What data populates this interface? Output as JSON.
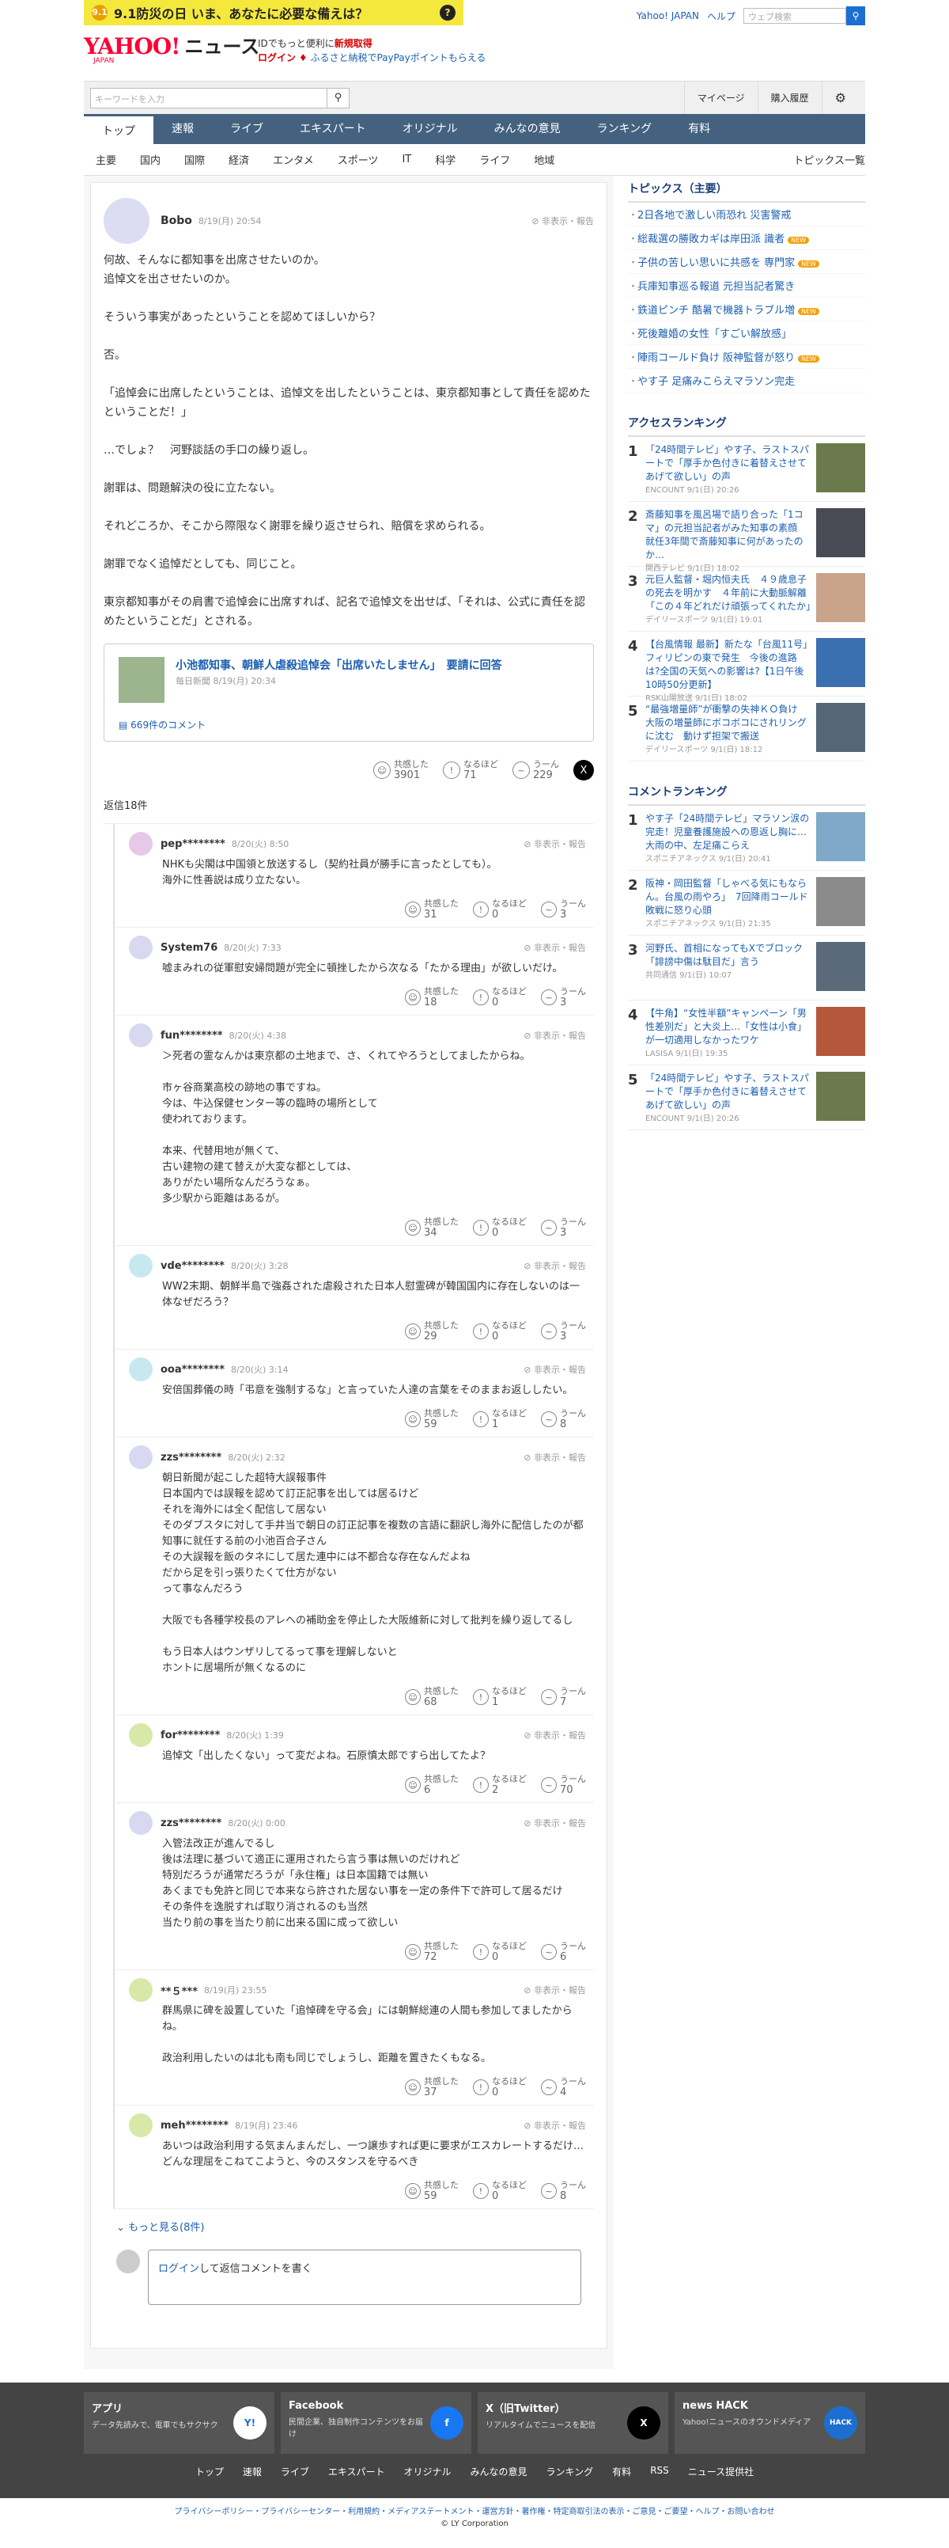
{
  "banner": {
    "icon": "9.1",
    "text": "9.1防災の日 いま、あなたに必要な備えは？"
  },
  "top_links": {
    "yahoo_japan": "Yahoo! JAPAN",
    "help": "ヘルプ",
    "search_placeholder": "ウェブ検索"
  },
  "logo": {
    "yahoo": "YAHOO!",
    "japan": "JAPAN",
    "news": "ニュース"
  },
  "promo": {
    "line1_prefix": "IDでもっと便利に",
    "line1_link": "新規取得",
    "login": "ログイン",
    "line2": "ふるさと納税でPayPayポイントもらえる"
  },
  "searchbar": {
    "placeholder": "キーワードを入力",
    "mypage": "マイページ",
    "history": "購入履歴"
  },
  "global_nav": [
    "トップ",
    "速報",
    "ライブ",
    "エキスパート",
    "オリジナル",
    "みんなの意見",
    "ランキング",
    "有料"
  ],
  "sub_nav": [
    "主要",
    "国内",
    "国際",
    "経済",
    "エンタメ",
    "スポーツ",
    "IT",
    "科学",
    "ライフ",
    "地域"
  ],
  "sub_nav_more": "トピックス一覧",
  "post": {
    "user": "Bobo",
    "time": "8/19(月) 20:54",
    "report": "非表示・報告",
    "paragraphs": [
      "何故、そんなに都知事を出席させたいのか。\n追悼文を出させたいのか。",
      "そういう事実があったということを認めてほしいから？",
      "否。",
      "「追悼会に出席したということは、追悼文を出したということは、東京都知事として責任を認めたということだ！」",
      "…でしょ？　河野談話の手口の繰り返し。",
      "謝罪は、問題解決の役に立たない。",
      "それどころか、そこから際限なく謝罪を繰り返させられ、賠償を求められる。",
      "謝罪でなく追悼だとしても、同じこと。",
      "東京都知事がその肩書で追悼会に出席すれば、記名で追悼文を出せば、「それは、公式に責任を認めたということだ」とされる。"
    ],
    "card": {
      "title": "小池都知事、朝鮮人虐殺追悼会「出席いたしません」　要請に回答",
      "source": "毎日新聞 8/19(月) 20:34",
      "comments": "669件のコメント"
    },
    "reactions": {
      "agree_label": "共感した",
      "agree": "3901",
      "naruhodo_label": "なるほど",
      "naruhodo": "71",
      "uun_label": "うーん",
      "uun": "229"
    }
  },
  "reply_count": "返信18件",
  "replies": [
    {
      "user": "pep********",
      "time": "8/20(火) 8:50",
      "text": "NHKも尖閣は中国領と放送するし（契約社員が勝手に言ったとしても）。\n海外に性善説は成り立たない。",
      "agree": "31",
      "naruhodo": "0",
      "uun": "3"
    },
    {
      "user": "System76",
      "time": "8/20(火) 7:33",
      "text": "嘘まみれの従軍慰安婦問題が完全に頓挫したから次なる「たかる理由」が欲しいだけ。",
      "agree": "18",
      "naruhodo": "0",
      "uun": "3"
    },
    {
      "user": "fun********",
      "time": "8/20(火) 4:38",
      "text": "＞死者の霊なんかは東京都の土地まで、さ、くれてやろうとしてましたからね。\n\n市ヶ谷商業高校の跡地の事ですね。\n今は、牛込保健センター等の臨時の場所として\n使われております。\n\n本来、代替用地が無くて、\n古い建物の建て替えが大変な都としては、\nありがたい場所なんだろうなぁ。\n多少駅から距離はあるが。",
      "agree": "34",
      "naruhodo": "0",
      "uun": "3"
    },
    {
      "user": "vde********",
      "time": "8/20(火) 3:28",
      "text": "WW2末期、朝鮮半島で強姦された虐殺された日本人慰霊碑が韓国国内に存在しないのは一体なぜだろう？",
      "agree": "29",
      "naruhodo": "0",
      "uun": "3"
    },
    {
      "user": "ooa********",
      "time": "8/20(火) 3:14",
      "text": "安倍国葬儀の時「弔意を強制するな」と言っていた人達の言葉をそのままお返ししたい。",
      "agree": "59",
      "naruhodo": "1",
      "uun": "8"
    },
    {
      "user": "zzs********",
      "time": "8/20(火) 2:32",
      "text": "朝日新聞が起こした超特大誤報事件\n日本国内では誤報を認めて訂正記事を出しては居るけど\nそれを海外には全く配信して居ない\nそのダブスタに対して手井当で朝日の訂正記事を複数の言語に翻訳し海外に配信したのが都知事に就任する前の小池百合子さん\nその大誤報を飯のタネにして居た連中には不都合な存在なんだよね\nだから足を引っ張りたくて仕方がない\nって事なんだろう\n\n大阪でも各種学校長のアレへの補助金を停止した大阪維新に対して批判を繰り返してるし\n\nもう日本人はウンザリしてるって事を理解しないと\nホントに居場所が無くなるのに",
      "agree": "68",
      "naruhodo": "1",
      "uun": "7"
    },
    {
      "user": "for********",
      "time": "8/20(火) 1:39",
      "text": "追悼文「出したくない」って変だよね。石原慎太郎ですら出してたよ？",
      "agree": "6",
      "naruhodo": "2",
      "uun": "70"
    },
    {
      "user": "zzs********",
      "time": "8/20(火) 0:00",
      "text": "入管法改正が進んでるし\n後は法理に基づいて適正に運用されたら言う事は無いのだけれど\n特別だろうが通常だろうが「永住権」は日本国籍では無い\nあくまでも免許と同じで本来なら許された居ない事を一定の条件下で許可して居るだけ\nその条件を逸脱すれば取り消されるのも当然\n当たり前の事を当たり前に出来る国に成って欲しい",
      "agree": "72",
      "naruhodo": "0",
      "uun": "6"
    },
    {
      "user": "**５***",
      "time": "8/19(月) 23:55",
      "text": "群馬県に碑を設置していた「追悼碑を守る会」には朝鮮総連の人間も参加してましたからね。\n\n政治利用したいのは北も南も同じでしょうし、距離を置きたくもなる。",
      "agree": "37",
      "naruhodo": "0",
      "uun": "4"
    },
    {
      "user": "meh********",
      "time": "8/19(月) 23:46",
      "text": "あいつは政治利用する気まんまんだし、一つ譲歩すれば更に要求がエスカレートするだけ…どんな理屈をこねてこようと、今のスタンスを守るべき",
      "agree": "59",
      "naruhodo": "0",
      "uun": "8"
    }
  ],
  "more": "もっと見る(8件)",
  "login_box": {
    "link": "ログイン",
    "text": "して返信コメントを書く"
  },
  "side": {
    "topics_title": "トピックス（主要）",
    "topics": [
      {
        "t": "2日各地で激しい雨恐れ 災害警戒",
        "b": ""
      },
      {
        "t": "総裁選の勝敗カギは岸田派 識者",
        "b": "NEW"
      },
      {
        "t": "子供の苦しい思いに共感を 専門家",
        "b": "NEW"
      },
      {
        "t": "兵庫知事巡る報道 元担当記者驚き",
        "b": ""
      },
      {
        "t": "鉄道ピンチ 酷暑で機器トラブル増",
        "b": "NEW"
      },
      {
        "t": "死後離婚の女性「すごい解放感」",
        "b": ""
      },
      {
        "t": "陣雨コールド負け 阪神監督が怒り",
        "b": "NEW"
      },
      {
        "t": "やす子 足痛みこらえマラソン完走",
        "b": ""
      }
    ],
    "access_title": "アクセスランキング",
    "access": [
      {
        "n": "1",
        "t": "「24時間テレビ」やす子、ラストスパートで「厚手か色付きに着替えさせてあげて欲しい」の声",
        "s": "ENCOUNT 9/1(日) 20:26",
        "c": "#6b7a4d"
      },
      {
        "n": "2",
        "t": "斎藤知事を風呂場で語り合った「1コマ」の元担当記者がみた知事の素顔　就任3年間で斎藤知事に何があったのか…",
        "s": "関西テレビ 9/1(日) 18:02",
        "c": "#4a4a55"
      },
      {
        "n": "3",
        "t": "元巨人監督・堀内恒夫氏　４９歳息子の死去を明かす　４年前に大動脈解離「この４年どれだけ頑張ってくれたか」",
        "s": "デイリースポーツ 9/1(日) 19:01",
        "c": "#c9a48a"
      },
      {
        "n": "4",
        "t": "【台風情報 最新】新たな「台風11号」フィリピンの東で発生　今後の進路は?全国の天気への影響は?【1日午後10時50分更新】",
        "s": "RSK山陽放送 9/1(日) 18:02",
        "c": "#3a6fb0"
      },
      {
        "n": "5",
        "t": "“最強増量師”が衝撃の失神ＫＯ負け　大阪の増量師にボコボコにされリングに沈む　動けず担架で搬送",
        "s": "デイリースポーツ 9/1(日) 18:12",
        "c": "#556677"
      }
    ],
    "comment_title": "コメントランキング",
    "comment": [
      {
        "n": "1",
        "t": "やす子「24時間テレビ」マラソン涙の完走！児童養護施設への恩返し胸に…大雨の中、左足痛こらえ",
        "s": "スポニチアネックス 9/1(日) 20:41",
        "c": "#7fa8c9"
      },
      {
        "n": "2",
        "t": "阪神・岡田監督「しゃべる気にもならん。台風の雨やろ」　7回降雨コールド敗戦に怒り心頭",
        "s": "スポニチアネックス 9/1(日) 21:35",
        "c": "#8a8a8a"
      },
      {
        "n": "3",
        "t": "河野氏、首相になってもXでブロック「誹謗中傷は駄目だ」言う",
        "s": "共同通信 9/1(日) 10:07",
        "c": "#5a6a7a"
      },
      {
        "n": "4",
        "t": "【牛角】“女性半額”キャンペーン「男性差別だ」と大炎上…「女性は小食」が一切適用しなかったワケ",
        "s": "LASISA 9/1(日) 19:35",
        "c": "#b5573a"
      },
      {
        "n": "5",
        "t": "「24時間テレビ」やす子、ラストスパートで「厚手か色付きに着替えさせてあげて欲しい」の声",
        "s": "ENCOUNT 9/1(日) 20:26",
        "c": "#6b7a4d"
      }
    ]
  },
  "footer": {
    "apps": [
      {
        "t": "アプリ",
        "d": "データ先読みで、電車でもサクサク",
        "i": "Y!"
      },
      {
        "t": "Facebook",
        "d": "民間企業、独自制作コンテンツをお届け",
        "i": "f"
      },
      {
        "t": "X（旧Twitter）",
        "d": "リアルタイムでニュースを配信",
        "i": "X"
      },
      {
        "t": "news HACK",
        "d": "Yahoo!ニュースのオウンドメディア",
        "i": "HACK"
      }
    ],
    "nav": [
      "トップ",
      "速報",
      "ライブ",
      "エキスパート",
      "オリジナル",
      "みんなの意見",
      "ランキング",
      "有料",
      "RSS",
      "ニュース提供社"
    ],
    "links": "プライバシーポリシー・プライバシーセンター・利用規約・メディアステートメント・運営方針・著作権・特定商取引法の表示・ご意見・ご要望・ヘルプ・お問い合わせ",
    "copyright": "© LY Corporation"
  }
}
